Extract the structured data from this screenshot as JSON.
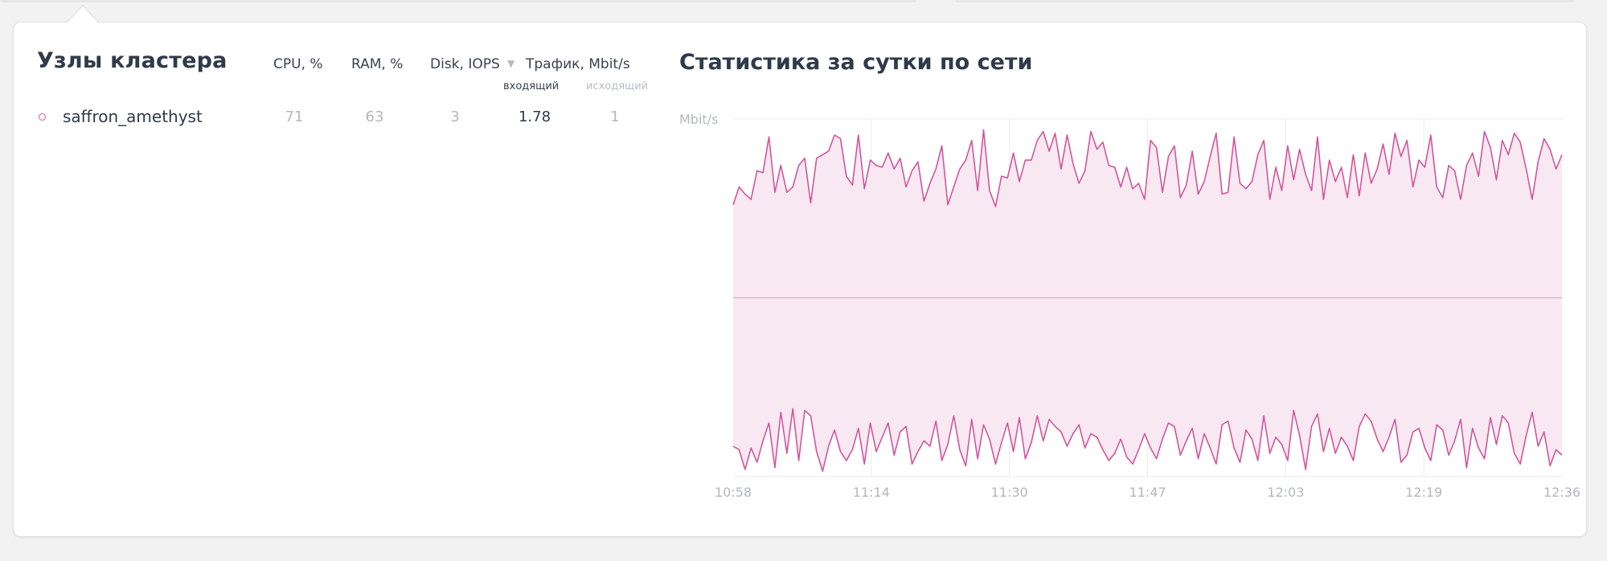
{
  "nodes_panel": {
    "title": "Узлы кластера",
    "columns": {
      "cpu": "CPU, %",
      "ram": "RAM, %",
      "disk": "Disk, IOPS",
      "traffic": "Трафик, Mbit/s",
      "traffic_in": "входящий",
      "traffic_out": "исходящий"
    },
    "rows": [
      {
        "name": "saffron_amethyst",
        "cpu": "71",
        "ram": "63",
        "disk": "3",
        "traffic_in": "1.78",
        "traffic_out": "1"
      }
    ]
  },
  "stats_panel": {
    "title": "Статистика за сутки по сети"
  },
  "colors": {
    "accent": "#d4559a",
    "fill": "#f8e8f2",
    "title": "#2f3a4a",
    "muted": "#b3b7be"
  },
  "chart_data": {
    "type": "area",
    "ylabel": "Mbit/s",
    "x_ticks": [
      "10:58",
      "11:14",
      "11:30",
      "11:47",
      "12:03",
      "12:19",
      "12:36"
    ],
    "ylim": [
      -1,
      1
    ],
    "grid": true,
    "series": [
      {
        "values": [
          0.52,
          0.62,
          0.58,
          0.55,
          0.71,
          0.7,
          0.9,
          0.59,
          0.74,
          0.59,
          0.62,
          0.74,
          0.78,
          0.53,
          0.78,
          0.8,
          0.82,
          0.91,
          0.89,
          0.68,
          0.63,
          0.91,
          0.61,
          0.77,
          0.74,
          0.73,
          0.81,
          0.72,
          0.78,
          0.62,
          0.71,
          0.76,
          0.54,
          0.64,
          0.72,
          0.85,
          0.52,
          0.62,
          0.72,
          0.77,
          0.88,
          0.6,
          0.94,
          0.6,
          0.51,
          0.68,
          0.67,
          0.81,
          0.65,
          0.77,
          0.77,
          0.88,
          0.93,
          0.82,
          0.92,
          0.72,
          0.91,
          0.75,
          0.64,
          0.71,
          0.93,
          0.83,
          0.87,
          0.74,
          0.73,
          0.62,
          0.73,
          0.61,
          0.64,
          0.55,
          0.88,
          0.84,
          0.59,
          0.79,
          0.85,
          0.56,
          0.63,
          0.82,
          0.58,
          0.65,
          0.79,
          0.92,
          0.58,
          0.59,
          0.9,
          0.64,
          0.61,
          0.65,
          0.8,
          0.88,
          0.55,
          0.73,
          0.6,
          0.85,
          0.66,
          0.83,
          0.69,
          0.6,
          0.9,
          0.55,
          0.77,
          0.65,
          0.73,
          0.56,
          0.8,
          0.57,
          0.81,
          0.64,
          0.72,
          0.86,
          0.69,
          0.92,
          0.79,
          0.88,
          0.62,
          0.77,
          0.73,
          0.91,
          0.62,
          0.56,
          0.74,
          0.71,
          0.55,
          0.74,
          0.81,
          0.68,
          0.93,
          0.84,
          0.66,
          0.88,
          0.8,
          0.92,
          0.87,
          0.72,
          0.55,
          0.76,
          0.89,
          0.83,
          0.72,
          0.8
        ],
        "sign": 1
      },
      {
        "values": [
          0.83,
          0.85,
          0.96,
          0.84,
          0.92,
          0.8,
          0.7,
          0.95,
          0.64,
          0.87,
          0.62,
          0.91,
          0.63,
          0.66,
          0.86,
          0.97,
          0.83,
          0.74,
          0.86,
          0.91,
          0.85,
          0.73,
          0.93,
          0.7,
          0.86,
          0.78,
          0.7,
          0.88,
          0.75,
          0.72,
          0.93,
          0.86,
          0.8,
          0.83,
          0.69,
          0.91,
          0.82,
          0.66,
          0.85,
          0.94,
          0.68,
          0.9,
          0.71,
          0.79,
          0.93,
          0.81,
          0.7,
          0.86,
          0.67,
          0.9,
          0.81,
          0.66,
          0.8,
          0.68,
          0.72,
          0.75,
          0.83,
          0.76,
          0.71,
          0.84,
          0.76,
          0.78,
          0.85,
          0.91,
          0.87,
          0.79,
          0.89,
          0.93,
          0.85,
          0.76,
          0.84,
          0.9,
          0.79,
          0.7,
          0.72,
          0.88,
          0.8,
          0.73,
          0.9,
          0.76,
          0.84,
          0.93,
          0.71,
          0.69,
          0.84,
          0.92,
          0.74,
          0.79,
          0.91,
          0.66,
          0.87,
          0.78,
          0.82,
          0.91,
          0.63,
          0.77,
          0.96,
          0.72,
          0.65,
          0.86,
          0.73,
          0.87,
          0.78,
          0.83,
          0.91,
          0.72,
          0.65,
          0.69,
          0.79,
          0.86,
          0.78,
          0.68,
          0.92,
          0.88,
          0.75,
          0.73,
          0.84,
          0.91,
          0.71,
          0.74,
          0.88,
          0.8,
          0.68,
          0.95,
          0.73,
          0.84,
          0.9,
          0.67,
          0.82,
          0.66,
          0.7,
          0.87,
          0.93,
          0.77,
          0.64,
          0.83,
          0.75,
          0.94,
          0.85,
          0.88
        ],
        "sign": -1
      }
    ]
  }
}
